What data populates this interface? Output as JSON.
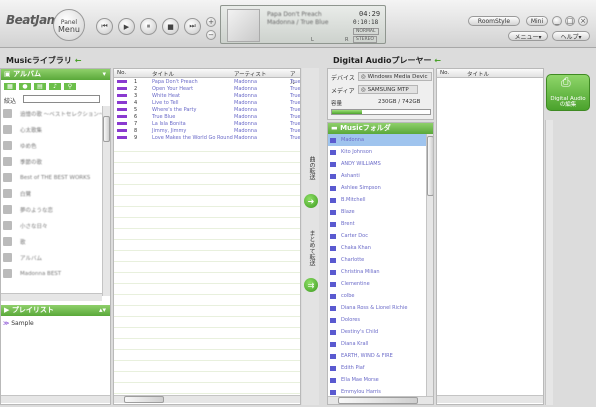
{
  "app": {
    "logo": "BeatJam",
    "panel_menu_line1": "Panel",
    "panel_menu_line2": "Menu"
  },
  "transport": {
    "prev": "⏮",
    "play": "▶",
    "pause": "⏸",
    "stop": "■",
    "next": "⏭"
  },
  "volume": {
    "up": "+",
    "down": "−"
  },
  "display": {
    "title": "Papa Don't Preach",
    "artist": "Madonna / True Blue",
    "time": "04:29",
    "elapsed": "0:10:18",
    "mode1": "NORMAL",
    "mode2": "STEREO",
    "l": "L",
    "r": "R"
  },
  "window": {
    "roomstyle": "RoomStyle",
    "mini": "Mini",
    "menu": "メニュー▾",
    "help": "ヘルプ▾"
  },
  "left": {
    "title": "Musicライブラリ",
    "arrow": "←",
    "album_header": "アルバム",
    "filter_label": "絞込",
    "albums": [
      "追憶の歌 〜ベストセレクション〜",
      "心太歌集",
      "ゆめ色",
      "季節の歌",
      "Best of THE BEST WORKS",
      "白鷺",
      "夢のような恋",
      "小さな日々",
      "歌",
      "アルバム",
      "Madonna BEST"
    ],
    "playlist_header": "プレイリスト",
    "playlists": [
      "Sample"
    ]
  },
  "tracks": {
    "columns": [
      "No.",
      "タイトル",
      "アーティスト",
      "アル"
    ],
    "rows": [
      {
        "no": "1",
        "title": "Papa Don't Preach",
        "artist": "Madonna",
        "album": "True"
      },
      {
        "no": "2",
        "title": "Open Your Heart",
        "artist": "Madonna",
        "album": "True"
      },
      {
        "no": "3",
        "title": "White Heat",
        "artist": "Madonna",
        "album": "True"
      },
      {
        "no": "4",
        "title": "Live to Tell",
        "artist": "Madonna",
        "album": "True"
      },
      {
        "no": "5",
        "title": "Where's the Party",
        "artist": "Madonna",
        "album": "True"
      },
      {
        "no": "6",
        "title": "True Blue",
        "artist": "Madonna",
        "album": "True"
      },
      {
        "no": "7",
        "title": "La Isla Bonita",
        "artist": "Madonna",
        "album": "True"
      },
      {
        "no": "8",
        "title": "Jimmy, Jimmy",
        "artist": "Madonna",
        "album": "True"
      },
      {
        "no": "9",
        "title": "Love Makes the World Go Round",
        "artist": "Madonna",
        "album": "True"
      }
    ]
  },
  "transfer": {
    "one": "曲の転送",
    "batch": "まとめて転送"
  },
  "right": {
    "title": "Digital Audioプレーヤー",
    "arrow": "←",
    "device_label": "デバイス",
    "device_value": "Windows Media Devic",
    "media_label": "メディア",
    "media_value": "SAMSUNG MTP",
    "capacity_label": "容量",
    "capacity_value": "230GB / 742GB",
    "capacity_fraction": 0.31,
    "folder_header": "Musicフォルダ",
    "folders": [
      "Madonna",
      "Kito Johnson",
      "ANDY WILLIAMS",
      "Ashanti",
      "Ashlee Simpson",
      "B.Mitchell",
      "Blaze",
      "Brent",
      "Carter Doc",
      "Chaka Khan",
      "Charlotte",
      "Christina Milian",
      "Clementine",
      "colbe",
      "Diana Ross & Lionel Richie",
      "Dolores",
      "Destiny's Child",
      "Diana Krall",
      "EARTH, WIND & FIRE",
      "Edith Piaf",
      "Ella Mae Morse",
      "Emmylou Harris"
    ],
    "columns": [
      "No.",
      "タイトル"
    ],
    "edit_line1": "Digital Audio",
    "edit_line2": "の編集"
  }
}
